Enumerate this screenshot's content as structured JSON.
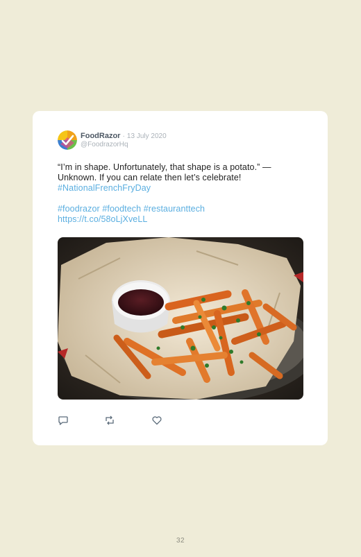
{
  "tweet": {
    "author": "FoodRazor",
    "separator": "·",
    "date": "13 July 2020",
    "handle": "@FoodrazorHq",
    "lines": [
      "“I’m in shape. Unfortunately, that shape is a potato.” —",
      "Unknown. If you can relate then let’s celebrate!"
    ],
    "hashtag_main": "#NationalFrenchFryDay",
    "hashtags": [
      "#foodrazor",
      "#foodtech",
      "#restauranttech"
    ],
    "link": "https://t.co/58oLjXveLL",
    "image_alt": "Sweet potato fries with dipping sauce",
    "icons": {
      "reply": "reply-icon",
      "retweet": "retweet-icon",
      "like": "heart-icon"
    }
  },
  "colors": {
    "background": "#efecd8",
    "card": "#ffffff",
    "link": "#5aaee0",
    "author": "#4c5763",
    "muted": "#aab1b8"
  },
  "page_number": "32"
}
